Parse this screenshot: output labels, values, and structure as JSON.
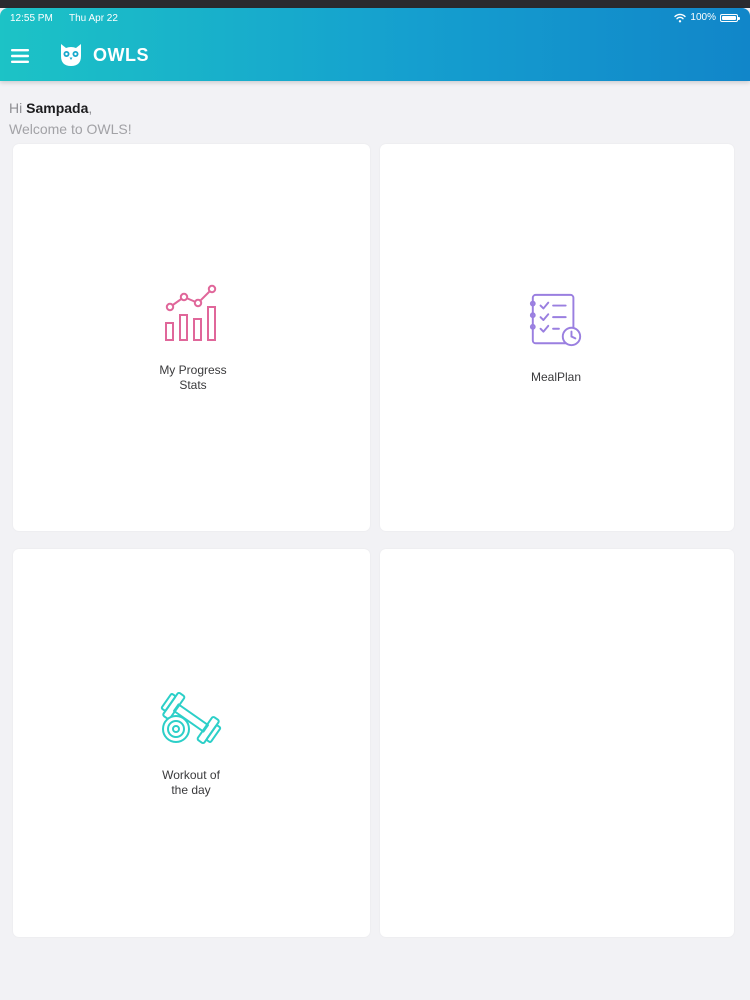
{
  "status_bar": {
    "time": "12:55 PM",
    "date": "Thu Apr 22",
    "battery": "100%"
  },
  "app_bar": {
    "title": "OWLS",
    "menu_icon": "hamburger-menu-icon",
    "logo_icon": "owl-logo-icon"
  },
  "greeting": {
    "prefix": "Hi ",
    "name": "Sampada",
    "suffix": ",",
    "welcome": "Welcome to OWLS!"
  },
  "cards": [
    {
      "label_line1": "My Progress",
      "label_line2": "Stats",
      "icon": "progress-chart-icon",
      "icon_color": "#e0679a"
    },
    {
      "label_line1": "MealPlan",
      "label_line2": "",
      "icon": "meal-plan-checklist-icon",
      "icon_color": "#9a7fe0"
    },
    {
      "label_line1": "Workout of",
      "label_line2": "the day",
      "icon": "dumbbell-icon",
      "icon_color": "#2ccfc8"
    },
    {
      "label_line1": "",
      "label_line2": "",
      "icon": "",
      "icon_color": ""
    }
  ],
  "colors": {
    "app_bar_start": "#1cc3c6",
    "app_bar_end": "#1186c9",
    "background": "#f2f2f5",
    "card": "#ffffff"
  }
}
